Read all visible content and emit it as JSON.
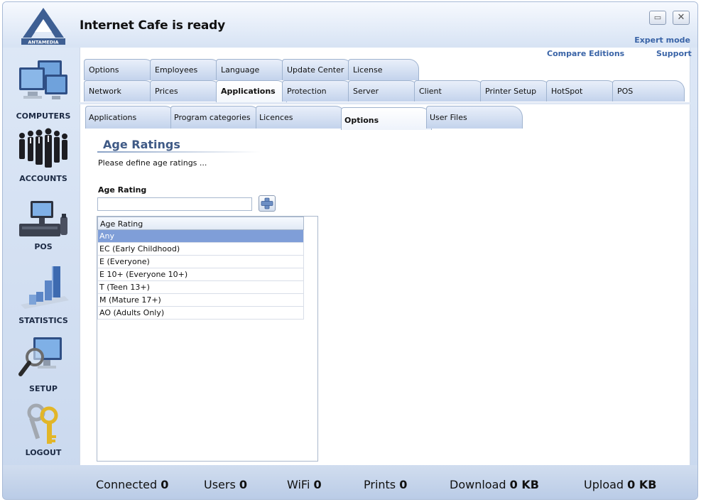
{
  "header": {
    "logo_text": "ANTAMEDIA",
    "status_title": "Internet Cafe is ready",
    "expert_mode": "Expert mode",
    "compare_editions": "Compare Editions",
    "support": "Support",
    "minimize_symbol": "▭",
    "close_symbol": "✕"
  },
  "sidebar": {
    "items": [
      {
        "label": "COMPUTERS",
        "icon": "computers-icon"
      },
      {
        "label": "ACCOUNTS",
        "icon": "accounts-icon"
      },
      {
        "label": "POS",
        "icon": "pos-icon"
      },
      {
        "label": "STATISTICS",
        "icon": "statistics-icon"
      },
      {
        "label": "SETUP",
        "icon": "setup-icon"
      },
      {
        "label": "LOGOUT",
        "icon": "keys-icon"
      }
    ]
  },
  "tabs": {
    "row1": [
      "Options",
      "Employees",
      "Language",
      "Update Center",
      "License"
    ],
    "row2": [
      "Network",
      "Prices",
      "Applications",
      "Protection",
      "Server",
      "Client",
      "Printer Setup",
      "HotSpot",
      "POS"
    ],
    "row2_active": "Applications",
    "subtabs": [
      "Applications",
      "Program categories",
      "Licences",
      "Options",
      "User Files"
    ],
    "subtab_active": "Options"
  },
  "form": {
    "title": "Age Ratings",
    "description": "Please define age ratings ...",
    "field_label": "Age Rating",
    "input_value": ""
  },
  "list": {
    "header": "Age Rating",
    "rows": [
      "Any",
      "EC (Early Childhood)",
      "E (Everyone)",
      "E 10+ (Everyone 10+)",
      "T (Teen 13+)",
      "M (Mature 17+)",
      "AO (Adults Only)"
    ],
    "selected": "Any"
  },
  "footer": {
    "connected_label": "Connected",
    "connected_value": "0",
    "users_label": "Users",
    "users_value": "0",
    "wifi_label": "WiFi",
    "wifi_value": "0",
    "prints_label": "Prints",
    "prints_value": "0",
    "download_label": "Download",
    "download_value": "0 KB",
    "upload_label": "Upload",
    "upload_value": "0 KB"
  },
  "colors": {
    "accent": "#3a64a7",
    "selection": "#7f9ed8",
    "title": "#3f5a86"
  }
}
